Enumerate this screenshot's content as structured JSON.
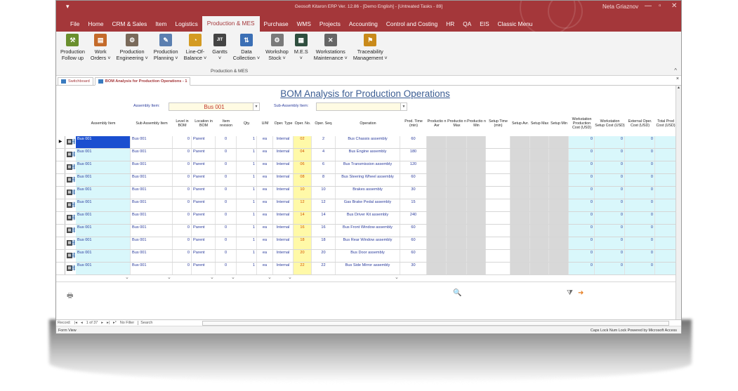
{
  "window": {
    "title": "Geosoft Kitaron ERP Ver. 12.86 - [Demo English] - [Untreated Tasks - 89]",
    "user": "Neta Griaznov"
  },
  "menu": [
    "File",
    "Home",
    "CRM & Sales",
    "Item",
    "Logistics",
    "Production & MES",
    "Purchase",
    "WMS",
    "Projects",
    "Accounting",
    "Control and Costing",
    "HR",
    "QA",
    "EIS",
    "Classic Menu"
  ],
  "menu_active": "Production & MES",
  "ribbon": {
    "buttons": [
      {
        "line1": "Production",
        "line2": "Follow up",
        "icon": "production-followup-icon",
        "color": "#6a8f2d"
      },
      {
        "line1": "Work",
        "line2": "Orders ˅",
        "icon": "work-orders-icon",
        "color": "#c46a2a"
      },
      {
        "line1": "Production",
        "line2": "Engineering ˅",
        "icon": "engineering-icon",
        "color": "#7a6a5a"
      },
      {
        "line1": "Production",
        "line2": "Planning ˅",
        "icon": "planning-icon",
        "color": "#5b7fb0"
      },
      {
        "line1": "Line-Of-",
        "line2": "Balance ˅",
        "icon": "line-of-balance-icon",
        "color": "#d49b22"
      },
      {
        "line1": "Gantts",
        "line2": "˅",
        "icon": "gantt-icon",
        "color": "#444444"
      },
      {
        "line1": "Data",
        "line2": "Collection ˅",
        "icon": "data-collection-icon",
        "color": "#3b6fb5"
      },
      {
        "line1": "Workshop",
        "line2": "Stock ˅",
        "icon": "workshop-stock-icon",
        "color": "#7a7a7a"
      },
      {
        "line1": "M.E.S",
        "line2": "˅",
        "icon": "mes-icon",
        "color": "#2f4f3f"
      },
      {
        "line1": "Workstations",
        "line2": "Maintenance ˅",
        "icon": "maintenance-icon",
        "color": "#666666"
      },
      {
        "line1": "Traceability",
        "line2": "Management ˅",
        "icon": "traceability-icon",
        "color": "#c98a1a"
      }
    ],
    "group_label": "Production & MES"
  },
  "tabs": [
    {
      "label": "Switchboard",
      "active": false
    },
    {
      "label": "BOM Analysis for Production Operations - 1",
      "active": true
    }
  ],
  "form": {
    "title": "BOM Analysis for Production Operations",
    "assembly_item_label": "Assembly Item:",
    "assembly_item_value": "Bus 001",
    "sub_assembly_label": "Sub-Assembly Item:",
    "sub_assembly_value": ""
  },
  "columns": [
    "Assembly Item",
    "Sub Assembly Item",
    "Level in BOM",
    "Location in BOM",
    "Item revision",
    "Qty.",
    "U/M",
    "Oper. Type",
    "Oper. No.",
    "Oper. Seq.",
    "Operation",
    "Prod. Time (min)",
    "Productio n Avr",
    "Productio n Max",
    "Productio n Min",
    "Setup Time (min)",
    "Setup Avr.",
    "Setup Max",
    "Setup Min",
    "Workstation Production Cost (USD)",
    "Workstation Setup Cost (USD)",
    "External Oper. Cost (USD)",
    "Total Prod Cost (USD)"
  ],
  "rows": [
    {
      "assembly": "Bus 001",
      "sub": "Bus 001",
      "level": "0",
      "location": "Parent",
      "rev": "0",
      "qty": "1",
      "um": "ea",
      "type": "Internal",
      "oper_no": "02",
      "seq": "2",
      "operation": "Bus Chassis assembly",
      "prod_time": "60",
      "ws_prod": "0",
      "ws_setup": "0",
      "ext": "0"
    },
    {
      "assembly": "Bus 001",
      "sub": "Bus 001",
      "level": "0",
      "location": "Parent",
      "rev": "0",
      "qty": "1",
      "um": "ea",
      "type": "Internal",
      "oper_no": "04",
      "seq": "4",
      "operation": "Bus Engine assembly",
      "prod_time": "180",
      "ws_prod": "0",
      "ws_setup": "0",
      "ext": "0"
    },
    {
      "assembly": "Bus 001",
      "sub": "Bus 001",
      "level": "0",
      "location": "Parent",
      "rev": "0",
      "qty": "1",
      "um": "ea",
      "type": "Internal",
      "oper_no": "06",
      "seq": "6",
      "operation": "Bus Transmission assembly",
      "prod_time": "120",
      "ws_prod": "0",
      "ws_setup": "0",
      "ext": "0"
    },
    {
      "assembly": "Bus 001",
      "sub": "Bus 001",
      "level": "0",
      "location": "Parent",
      "rev": "0",
      "qty": "1",
      "um": "ea",
      "type": "Internal",
      "oper_no": "08",
      "seq": "8",
      "operation": "Bus Steering Wheel assembly",
      "prod_time": "60",
      "ws_prod": "0",
      "ws_setup": "0",
      "ext": "0"
    },
    {
      "assembly": "Bus 001",
      "sub": "Bus 001",
      "level": "0",
      "location": "Parent",
      "rev": "0",
      "qty": "1",
      "um": "ea",
      "type": "Internal",
      "oper_no": "10",
      "seq": "10",
      "operation": "Brakes assembly",
      "prod_time": "30",
      "ws_prod": "0",
      "ws_setup": "0",
      "ext": "0"
    },
    {
      "assembly": "Bus 001",
      "sub": "Bus 001",
      "level": "0",
      "location": "Parent",
      "rev": "0",
      "qty": "1",
      "um": "ea",
      "type": "Internal",
      "oper_no": "12",
      "seq": "12",
      "operation": "Gas Brake Pedal assembly",
      "prod_time": "15",
      "ws_prod": "0",
      "ws_setup": "0",
      "ext": "0"
    },
    {
      "assembly": "Bus 001",
      "sub": "Bus 001",
      "level": "0",
      "location": "Parent",
      "rev": "0",
      "qty": "1",
      "um": "ea",
      "type": "Internal",
      "oper_no": "14",
      "seq": "14",
      "operation": "Bus Driver Kit assembly",
      "prod_time": "240",
      "ws_prod": "0",
      "ws_setup": "0",
      "ext": "0"
    },
    {
      "assembly": "Bus 001",
      "sub": "Bus 001",
      "level": "0",
      "location": "Parent",
      "rev": "0",
      "qty": "1",
      "um": "ea",
      "type": "Internal",
      "oper_no": "16",
      "seq": "16",
      "operation": "Bus Front Window assembly",
      "prod_time": "60",
      "ws_prod": "0",
      "ws_setup": "0",
      "ext": "0"
    },
    {
      "assembly": "Bus 001",
      "sub": "Bus 001",
      "level": "0",
      "location": "Parent",
      "rev": "0",
      "qty": "1",
      "um": "ea",
      "type": "Internal",
      "oper_no": "18",
      "seq": "18",
      "operation": "Bus Rear Window assembly",
      "prod_time": "60",
      "ws_prod": "0",
      "ws_setup": "0",
      "ext": "0"
    },
    {
      "assembly": "Bus 001",
      "sub": "Bus 001",
      "level": "0",
      "location": "Parent",
      "rev": "0",
      "qty": "1",
      "um": "ea",
      "type": "Internal",
      "oper_no": "20",
      "seq": "20",
      "operation": "Bus Door assembly",
      "prod_time": "60",
      "ws_prod": "0",
      "ws_setup": "0",
      "ext": "0"
    },
    {
      "assembly": "Bus 001",
      "sub": "Bus 001",
      "level": "0",
      "location": "Parent",
      "rev": "0",
      "qty": "1",
      "um": "ea",
      "type": "Internal",
      "oper_no": "22",
      "seq": "22",
      "operation": "Bus Side Mirror assembly",
      "prod_time": "30",
      "ws_prod": "0",
      "ws_setup": "0",
      "ext": "0"
    }
  ],
  "navigation": {
    "record_label": "Record:",
    "position": "1 of 37",
    "filter": "No Filter",
    "search": "Search"
  },
  "status": {
    "left": "Form View",
    "right": "Caps Lock   Num Lock   Powered by Microsoft Access"
  },
  "colors": {
    "accent": "#a4373a",
    "cyan_cell": "#d9f7fb",
    "yellow_cell": "#fff9a8",
    "gray_cell": "#d8d8d8",
    "oper_no_text": "#d35400"
  }
}
